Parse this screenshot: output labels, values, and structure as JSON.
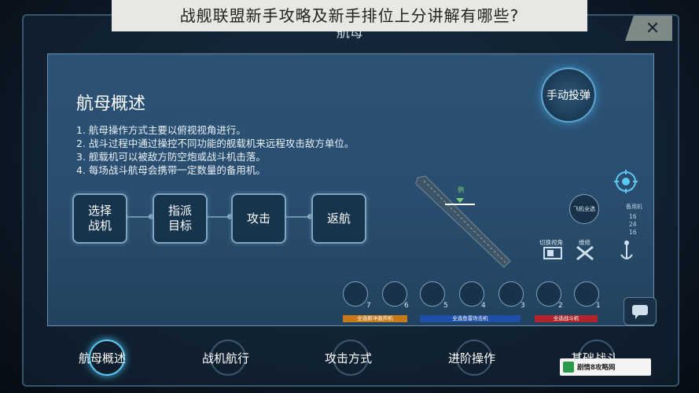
{
  "banner": {
    "text": "战舰联盟新手攻略及新手排位上分讲解有哪些?"
  },
  "window": {
    "title": "航母",
    "close_symbol": "✕"
  },
  "panel": {
    "title": "航母概述",
    "lines": [
      "1. 航母操作方式主要以俯视视角进行。",
      "2. 战斗过程中通过操控不同功能的舰载机来远程攻击敌方单位。",
      "3. 舰载机可以被敌方防空炮或战斗机击落。",
      "4. 每场战斗航母会携带一定数量的备用机。"
    ],
    "steps": [
      {
        "line1": "选择",
        "line2": "战机"
      },
      {
        "line1": "指派",
        "line2": "目标"
      },
      {
        "line1": "攻击",
        "line2": ""
      },
      {
        "line1": "返航",
        "line2": ""
      }
    ]
  },
  "hud": {
    "manual_button": "手动投弹",
    "plane_label": "鹞",
    "select_all_label": "飞机全选",
    "switch_view_label": "切换视角",
    "repair_label": "维修",
    "reserve_label": "备用机",
    "reserve_counts": [
      "16",
      "24",
      "16"
    ],
    "squad_numbers": [
      "7",
      "6",
      "5",
      "4",
      "3",
      "2",
      "1"
    ],
    "squad_bars": [
      {
        "label": "全选俯冲轰炸机",
        "color": "#c87a18"
      },
      {
        "label": "全选鱼雷攻击机",
        "color": "#1e4fa8"
      },
      {
        "label": "全选战斗机",
        "color": "#b2242c"
      }
    ]
  },
  "tabs": [
    "航母概述",
    "战机航行",
    "攻击方式",
    "进阶操作",
    "基础战斗"
  ],
  "watermark": {
    "text": "剧情8攻略网"
  }
}
